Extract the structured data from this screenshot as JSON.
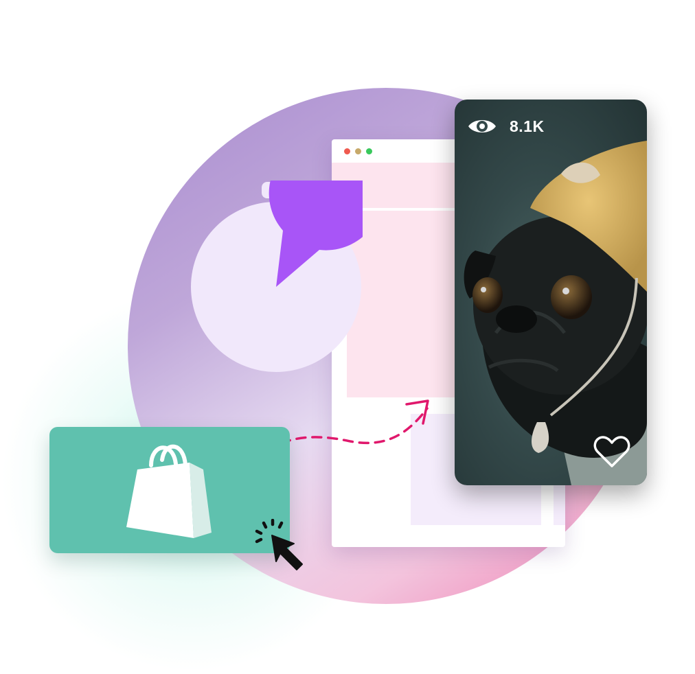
{
  "stats": {
    "views": "8.1K"
  },
  "icons": {
    "views": "eye-icon",
    "like": "heart-icon",
    "timer": "stopwatch-icon",
    "store": "shopping-bag-icon",
    "pointer": "cursor-icon"
  },
  "colors": {
    "accent_purple": "#a855f7",
    "store_green": "#5fc1ae",
    "arrow_pink": "#e0186c",
    "browser_pink": "#fde4ee",
    "browser_lavender": "#f4ecfb"
  }
}
